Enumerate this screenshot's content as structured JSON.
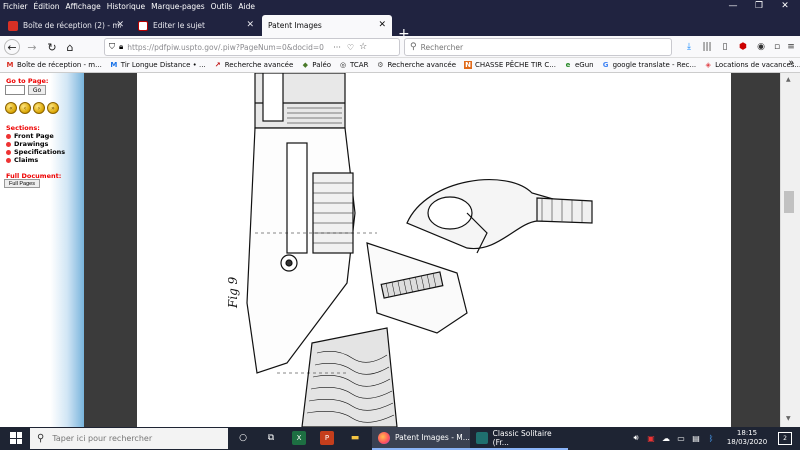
{
  "menubar": {
    "items": [
      "Fichier",
      "Édition",
      "Affichage",
      "Historique",
      "Marque-pages",
      "Outils",
      "Aide"
    ]
  },
  "window_controls": {
    "minimize": "—",
    "restore": "❐",
    "close": "✕"
  },
  "tabs": [
    {
      "label": "Boîte de réception (2) - marc.b",
      "close": "✕",
      "active": false
    },
    {
      "label": "Editer le sujet",
      "close": "✕",
      "active": false
    },
    {
      "label": "Patent Images",
      "close": "✕",
      "active": true
    }
  ],
  "new_tab": "+",
  "navbar": {
    "url": "https://pdfpiw.uspto.gov/.piw?PageNum=0&docid=0",
    "url_more": "···",
    "search_placeholder": "Rechercher"
  },
  "bookmarks": [
    {
      "label": "Boîte de réception - m...",
      "icon": "M",
      "color": "#d93025"
    },
    {
      "label": "Tir Longue Distance • ...",
      "icon": "M",
      "color": "#1a73e8"
    },
    {
      "label": "Recherche avancée",
      "icon": "↗",
      "color": "#b00"
    },
    {
      "label": "Paléo",
      "icon": "◆",
      "color": "#4a7a2a"
    },
    {
      "label": "TCAR",
      "icon": "◎",
      "color": "#222"
    },
    {
      "label": "Recherche avancée",
      "icon": "⚙",
      "color": "#555"
    },
    {
      "label": "CHASSE PÊCHE TIR C...",
      "icon": "N",
      "color": "#e06a1a"
    },
    {
      "label": "eGun",
      "icon": "e",
      "color": "#2a8a2a"
    },
    {
      "label": "google translate - Rec...",
      "icon": "G",
      "color": "#4285f4"
    },
    {
      "label": "Locations de vacances...",
      "icon": "◈",
      "color": "#e0454a"
    }
  ],
  "bookmarks_overflow": "»",
  "sidebar": {
    "goto_label": "Go to Page:",
    "goto_button": "Go",
    "sections_label": "Sections:",
    "sections": [
      "Front Page",
      "Drawings",
      "Specifications",
      "Claims"
    ],
    "full_document_label": "Full Document:",
    "full_pages_button": "Full Pages"
  },
  "taskbar": {
    "search_placeholder": "Taper ici pour rechercher",
    "apps": [
      {
        "label": "Patent Images - M...",
        "active": true
      },
      {
        "label": "Classic Solitaire (Fr...",
        "active": false
      }
    ],
    "time": "18:15",
    "date": "18/03/2020",
    "notifications": "2"
  }
}
